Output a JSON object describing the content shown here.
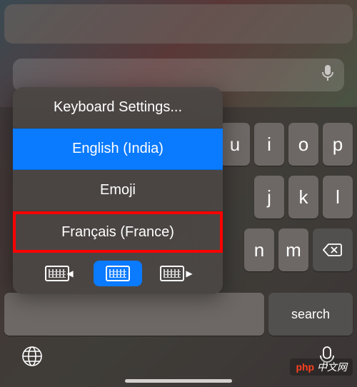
{
  "popup": {
    "settings": "Keyboard Settings...",
    "items": [
      "English (India)",
      "Emoji",
      "Français (France)"
    ],
    "selectedIndex": 0,
    "highlightedIndex": 2
  },
  "keyboard": {
    "row1": [
      "u",
      "i",
      "o",
      "p"
    ],
    "row2": [
      "j",
      "k",
      "l"
    ],
    "row3": [
      "n",
      "m"
    ],
    "searchLabel": "search"
  },
  "watermark": {
    "brand": "php",
    "text": " 中文网"
  }
}
